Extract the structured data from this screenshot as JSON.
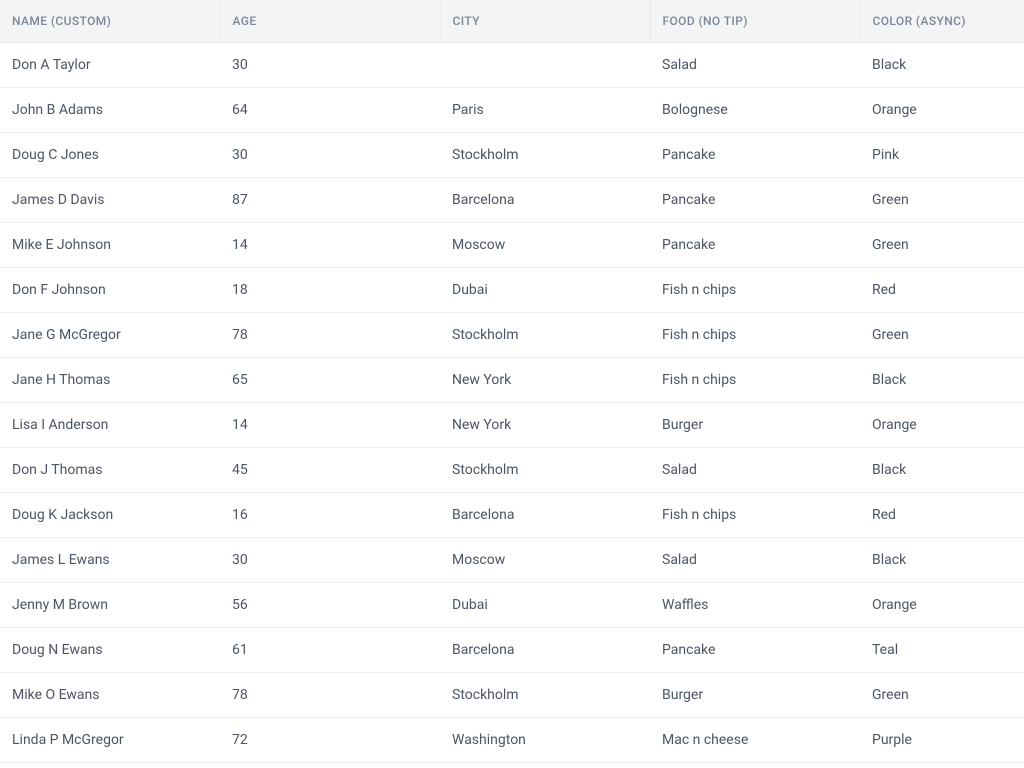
{
  "table": {
    "columns": [
      {
        "key": "name",
        "label": "NAME (CUSTOM)"
      },
      {
        "key": "age",
        "label": "AGE"
      },
      {
        "key": "city",
        "label": "CITY"
      },
      {
        "key": "food",
        "label": "FOOD (NO TIP)"
      },
      {
        "key": "color",
        "label": "COLOR (ASYNC)"
      }
    ],
    "rows": [
      {
        "name": "Don A Taylor",
        "age": "30",
        "city": "",
        "food": "Salad",
        "color": "Black"
      },
      {
        "name": "John B Adams",
        "age": "64",
        "city": "Paris",
        "food": "Bolognese",
        "color": "Orange"
      },
      {
        "name": "Doug C Jones",
        "age": "30",
        "city": "Stockholm",
        "food": "Pancake",
        "color": "Pink"
      },
      {
        "name": "James D Davis",
        "age": "87",
        "city": "Barcelona",
        "food": "Pancake",
        "color": "Green"
      },
      {
        "name": "Mike E Johnson",
        "age": "14",
        "city": "Moscow",
        "food": "Pancake",
        "color": "Green"
      },
      {
        "name": "Don F Johnson",
        "age": "18",
        "city": "Dubai",
        "food": "Fish n chips",
        "color": "Red"
      },
      {
        "name": "Jane G McGregor",
        "age": "78",
        "city": "Stockholm",
        "food": "Fish n chips",
        "color": "Green"
      },
      {
        "name": "Jane H Thomas",
        "age": "65",
        "city": "New York",
        "food": "Fish n chips",
        "color": "Black"
      },
      {
        "name": "Lisa I Anderson",
        "age": "14",
        "city": "New York",
        "food": "Burger",
        "color": "Orange"
      },
      {
        "name": "Don J Thomas",
        "age": "45",
        "city": "Stockholm",
        "food": "Salad",
        "color": "Black"
      },
      {
        "name": "Doug K Jackson",
        "age": "16",
        "city": "Barcelona",
        "food": "Fish n chips",
        "color": "Red"
      },
      {
        "name": "James L Ewans",
        "age": "30",
        "city": "Moscow",
        "food": "Salad",
        "color": "Black"
      },
      {
        "name": "Jenny M Brown",
        "age": "56",
        "city": "Dubai",
        "food": "Waffles",
        "color": "Orange"
      },
      {
        "name": "Doug N Ewans",
        "age": "61",
        "city": "Barcelona",
        "food": "Pancake",
        "color": "Teal"
      },
      {
        "name": "Mike O Ewans",
        "age": "78",
        "city": "Stockholm",
        "food": "Burger",
        "color": "Green"
      },
      {
        "name": "Linda P McGregor",
        "age": "72",
        "city": "Washington",
        "food": "Mac n cheese",
        "color": "Purple"
      }
    ]
  }
}
